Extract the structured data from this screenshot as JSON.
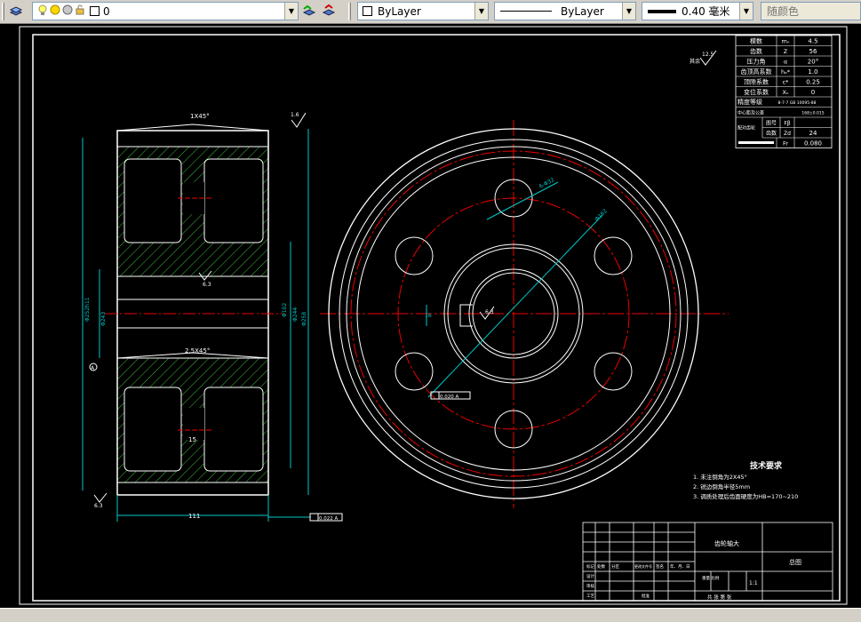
{
  "toolbar": {
    "layer_value": "0",
    "color_value": "ByLayer",
    "linetype_value": "ByLayer",
    "lineweight_value": "0.40 毫米",
    "plotstyle_value": "随颜色"
  },
  "drawing": {
    "params_table": [
      {
        "name": "模数",
        "sym": "mₙ",
        "value": "4.5"
      },
      {
        "name": "齿数",
        "sym": "Z",
        "value": "56"
      },
      {
        "name": "压力角",
        "sym": "α",
        "value": "20°"
      },
      {
        "name": "齿顶高系数",
        "sym": "hₐ*",
        "value": "1.0"
      },
      {
        "name": "顶隙系数",
        "sym": "c*",
        "value": "0.25"
      },
      {
        "name": "变位系数",
        "sym": "Xₙ",
        "value": "0"
      },
      {
        "name": "精度等级",
        "sym": "",
        "value": "8-7-7 GB 10095-88"
      },
      {
        "name": "中心距及公差",
        "sym": "",
        "value": "168±0.015"
      }
    ],
    "paired_gear_label": "配对齿轮",
    "paired_rows": [
      {
        "name": "图号",
        "sym": "Fβ",
        "value": ""
      },
      {
        "name": "齿数",
        "sym": "Zd",
        "value": "24"
      }
    ],
    "last_row": {
      "sym": "Fr",
      "value": "0.080"
    },
    "tech_title": "技术要求",
    "tech_items": [
      "1.  未注倒角为2X45°",
      "2.  锐边倒角半径5mm",
      "3.  调质处理后齿面硬度为HB=170~210"
    ],
    "dims": {
      "chamfer_top": "1X45°",
      "chamfer_mid": "2.5X45°",
      "rough_top": "1.6",
      "rough_mid": "6.3",
      "rough_bottom": "6.3",
      "rough_center": "6.3",
      "rough_topright": "12.5",
      "width": "111",
      "d1": "Φ102",
      "d2": "Φ244",
      "d3": "Φ258",
      "d_left1": "Φ252h11",
      "d_left2": "Φ243",
      "web": "15",
      "hub_gap": "15",
      "bore_label": "Φ52",
      "pcd_label": "Φ162",
      "hole_label": "6-Φ32",
      "keyway": "16",
      "tol_frame_1": "0.022 A",
      "tol_frame_2": "0.020 A",
      "datum": "A",
      "rough_other": "其余"
    },
    "title_block": {
      "part_name": "齿轮轴大",
      "company": "总图",
      "scale": "1:1",
      "row_labels": [
        "标记",
        "处数",
        "分区",
        "更改文件号",
        "签名",
        "年、月、日"
      ],
      "left_labels": [
        "设计",
        "审核",
        "工艺"
      ],
      "bottom_mid": "批准",
      "bottom_right": "共 张 第 张",
      "weight_label": "重量 比例"
    }
  }
}
